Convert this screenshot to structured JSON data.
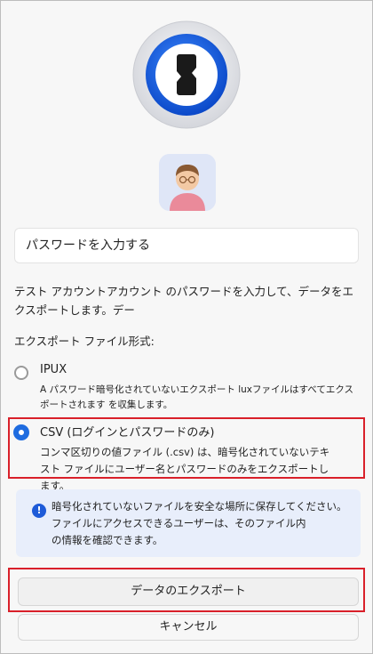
{
  "password_field": {
    "placeholder": "パスワードを入力する"
  },
  "description": "テスト アカウントアカウント のパスワードを入力して、データをエクスポートします。デー",
  "format_label": "エクスポート ファイル形式:",
  "options": [
    {
      "title": "IPUX",
      "description": "A パスワード暗号化されていないエクスポート luxファイルはすべてエクスポートされます を収集します。",
      "selected": false
    },
    {
      "title": "CSV (ログインとパスワードのみ)",
      "description": "コンマ区切りの値ファイル (.csv) は、暗号化されていないテキスト ファイルにユーザー名とパスワードのみをエクスポートします。",
      "selected": true
    }
  ],
  "notice": {
    "icon": "info-icon",
    "lines": [
      "暗号化されていないファイルを安全な場所に保存してください。",
      "ファイルにアクセスできるユーザーは、そのファイル内",
      "の情報を確認できます。"
    ]
  },
  "buttons": {
    "export": "データのエクスポート",
    "cancel": "キャンセル"
  },
  "colors": {
    "accent": "#1e6ce0",
    "highlight": "#d9202a",
    "notice_bg": "#e8eefb"
  }
}
